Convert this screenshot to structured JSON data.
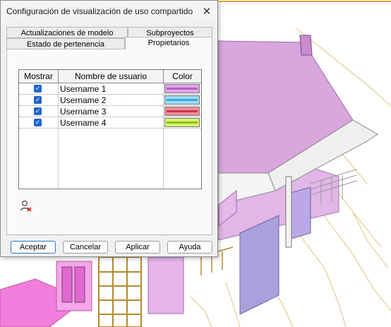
{
  "dialog": {
    "title": "Configuración de visualización de uso compartido",
    "tabs": [
      {
        "label": "Actualizaciones de modelo"
      },
      {
        "label": "Subproyectos"
      },
      {
        "label": "Estado de pertenencia"
      },
      {
        "label": "Propietarios"
      }
    ],
    "active_tab": "Propietarios",
    "table": {
      "columns": [
        "Mostrar",
        "Nombre de usuario",
        "Color"
      ],
      "rows": [
        {
          "show": true,
          "user": "Username 1",
          "color": "#b95fc6",
          "fill": "#e0a6e4"
        },
        {
          "show": true,
          "user": "Username 2",
          "color": "#3aa8d8",
          "fill": "#9dd9f4"
        },
        {
          "show": true,
          "user": "Username 3",
          "color": "#c8384e",
          "fill": "#f08a9a"
        },
        {
          "show": true,
          "user": "Username 4",
          "color": "#8ec21a",
          "fill": "#d7f56e"
        }
      ]
    },
    "buttons": {
      "ok": "Aceptar",
      "cancel": "Cancelar",
      "apply": "Aplicar",
      "help": "Ayuda"
    },
    "icons": {
      "close": "close-icon",
      "remove_user": "remove-user-icon"
    }
  },
  "scene": {
    "description_colors": {
      "roof": "#d8a8dc",
      "wall": "#aaa0dc",
      "frame": "#c9a24a"
    }
  }
}
